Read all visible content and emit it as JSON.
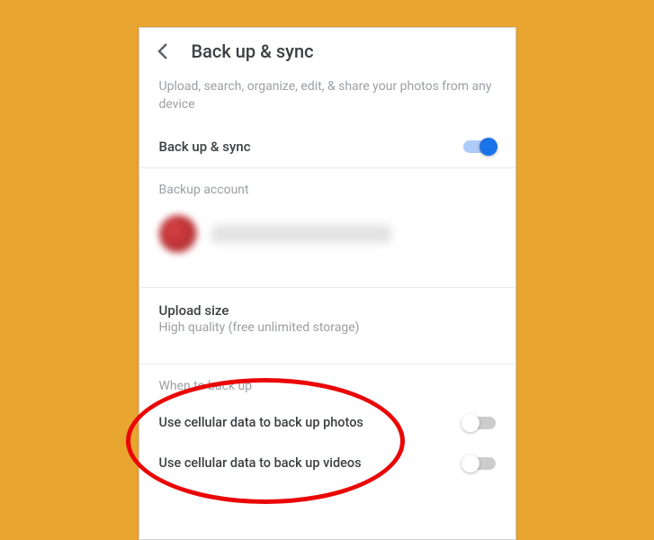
{
  "header": {
    "title": "Back up & sync"
  },
  "subtitle": "Upload, search, organize, edit, & share your photos from any device",
  "master_toggle": {
    "label": "Back up & sync",
    "state": "on"
  },
  "backup_account": {
    "header": "Backup account"
  },
  "upload": {
    "title": "Upload size",
    "subtitle": "High quality (free unlimited storage)"
  },
  "when": {
    "header": "When to back up",
    "items": [
      {
        "label": "Use cellular data to back up photos",
        "state": "off"
      },
      {
        "label": "Use cellular data to back up videos",
        "state": "off"
      }
    ]
  },
  "colors": {
    "accent": "#1a73e8"
  }
}
